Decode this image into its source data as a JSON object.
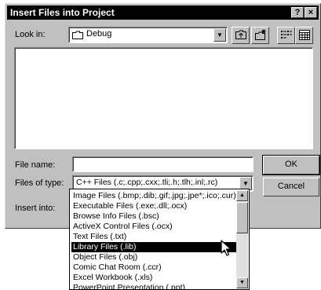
{
  "dialog": {
    "title": "Insert Files into Project",
    "help_button": "?",
    "close_button": "×"
  },
  "look_in": {
    "label": "Look in:",
    "value": "Debug"
  },
  "file_name": {
    "label": "File name:",
    "value": ""
  },
  "files_of_type": {
    "label": "Files of type:",
    "value": "C++ Files (.c;.cpp;.cxx;.tli;.h;.tlh;.inl;.rc)",
    "options": [
      "Image Files (.bmp;.dib;.gif;.jpg;.jpe*;.ico;.cur)",
      "Executable Files (.exe;.dll;.ocx)",
      "Browse Info Files (.bsc)",
      "ActiveX Control Files (.ocx)",
      "Text Files (.txt)",
      "Library Files (.lib)",
      "Object Files (.obj)",
      "Comic Chat Room (.ccr)",
      "Excel Workbook (.xls)",
      "PowerPoint Presentation (.ppt)"
    ],
    "selected_index": 5
  },
  "insert_into": {
    "label": "Insert into:"
  },
  "buttons": {
    "ok": "OK",
    "cancel": "Cancel"
  }
}
